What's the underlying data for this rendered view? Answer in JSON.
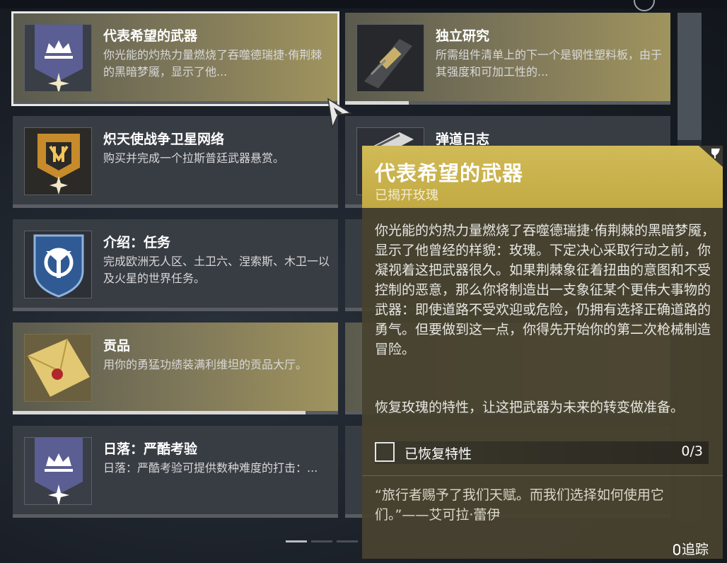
{
  "cards": [
    {
      "title": "代表希望的武器",
      "desc": "你光能的灼热力量燃烧了吞噬德瑞捷·侑荆棘的黑暗梦魇，显示了他...",
      "icon": "crown-banner-icon",
      "selected": true,
      "progress": 0
    },
    {
      "title": "独立研究",
      "desc": "所需组件清单上的下一个是钢性塑料板，由于其强度和可加工性的...",
      "icon": "weapon-part-icon",
      "selected": false,
      "progress": 0.19
    },
    {
      "title": "炽天使战争卫星网络",
      "desc": "购买并完成一个拉斯普廷武器悬赏。",
      "icon": "rasputin-emblem-icon"
    },
    {
      "title": "弹道日志",
      "desc": "",
      "icon": "weapon-frame-icon"
    },
    {
      "title": "介绍：任务",
      "desc": "完成欧洲无人区、土卫六、涅索斯、木卫一以及火星的世界任务。",
      "icon": "destiny-shield-icon"
    },
    {
      "title": "贡品",
      "desc": "用你的勇猛功绩装满利维坦的贡品大厅。",
      "icon": "sealed-envelope-icon",
      "progress": 0.9
    },
    {
      "title": "日落：严酷考验",
      "desc": "日落：严酷考验可提供数种难度的打击：...",
      "icon": "crown-banner-icon"
    }
  ],
  "tooltip": {
    "title": "代表希望的武器",
    "subtitle": "已揭开玫瑰",
    "description": "你光能的灼热力量燃烧了吞噬德瑞捷·侑荆棘的黑暗梦魇，显示了他曾经的样貌：玫瑰。下定决心采取行动之前，你凝视着这把武器很久。如果荆棘象征着扭曲的意图和不受控制的恶意，那么你将制造出一支象征某个更伟大事物的武器：即使道路不受欢迎或危险，仍拥有选择正确道路的勇气。但要做到这一点，你得先开始你的第二次枪械制造冒险。",
    "note": "恢复玫瑰的特性，让这把武器为未来的转变做准备。",
    "objective": {
      "label": "已恢复特性",
      "count": "0/3"
    },
    "quote": "“旅行者赐予了我们天赋。而我们选择如何使用它们。”——艾可拉·蕾伊",
    "track_label": "追踪"
  }
}
